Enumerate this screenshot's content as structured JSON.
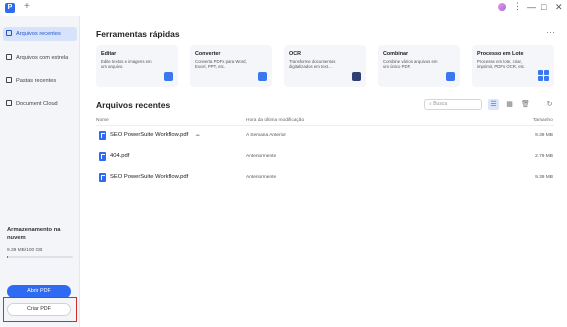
{
  "titlebar": {
    "logo_letter": "P",
    "new_tab": "+",
    "more": "⋮",
    "minimize": "—",
    "maximize": "□",
    "close": "✕"
  },
  "sidebar": {
    "items": [
      {
        "label": "Arquivos recentes",
        "active": true
      },
      {
        "label": "Arquivos com estrela",
        "active": false
      },
      {
        "label": "Pastas recentes",
        "active": false
      },
      {
        "label": "Document Cloud",
        "active": false
      }
    ],
    "storage_title": "Armazenamento na nuvem",
    "storage_size": "9.39 MB/100 GB",
    "storage_fraction": 0.0001,
    "open_button": "Abrir PDF",
    "create_button": "Criar PDF"
  },
  "tools": {
    "heading": "Ferramentas rápidas",
    "more": "···",
    "cards": [
      {
        "title": "Editar",
        "desc": "Edite textos e imagens em um arquivo.",
        "icon": "edit-icon"
      },
      {
        "title": "Converter",
        "desc": "Converta PDFs para Word, Excel, PPT, etc.",
        "icon": "convert-icon"
      },
      {
        "title": "OCR",
        "desc": "Transforme documentos digitalizados em text…",
        "icon": "ocr-icon"
      },
      {
        "title": "Combinar",
        "desc": "Combine vários arquivos em um único PDF.",
        "icon": "combine-icon"
      },
      {
        "title": "Processo em Lote",
        "desc": "Processe em lote, criar, imprimir, PDFs OCR, etc.",
        "icon": "batch-grid-icon"
      }
    ]
  },
  "recent": {
    "heading": "Arquivos recentes",
    "search_placeholder": "Busca",
    "columns": {
      "name": "Nome",
      "modified": "Hora da última modificação",
      "size": "Tamanho"
    },
    "files": [
      {
        "name": "SEO PowerSuite Workflow.pdf",
        "modified": "A Semana Anterior",
        "size": "9.39 MB",
        "cloud": true
      },
      {
        "name": "404.pdf",
        "modified": "Anteriormente",
        "size": "2.79 MB",
        "cloud": false
      },
      {
        "name": "SEO PowerSuite Workflow.pdf",
        "modified": "Anteriormente",
        "size": "9.39 MB",
        "cloud": false
      }
    ]
  },
  "colors": {
    "accent": "#2f6bf2",
    "highlight": "#d62b2b",
    "sidebar_bg": "#f4f5f8"
  }
}
